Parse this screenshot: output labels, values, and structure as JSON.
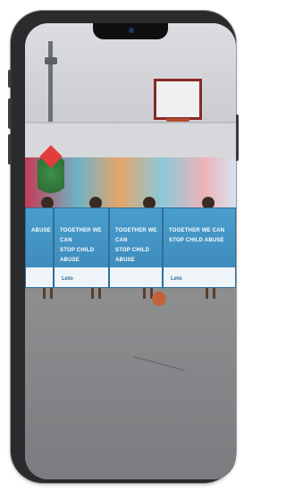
{
  "banners": [
    {
      "line1": "",
      "line2": "ABUSE",
      "logo": ""
    },
    {
      "line1": "TOGETHER WE CAN",
      "line2": "STOP CHILD ABUSE",
      "logo": "Leto"
    },
    {
      "line1": "TOGETHER WE CAN",
      "line2": "STOP CHILD ABUSE",
      "logo": ""
    },
    {
      "line1": "TOGETHER WE CAN",
      "line2": "STOP CHILD ABUSE",
      "logo": "Leto"
    }
  ]
}
